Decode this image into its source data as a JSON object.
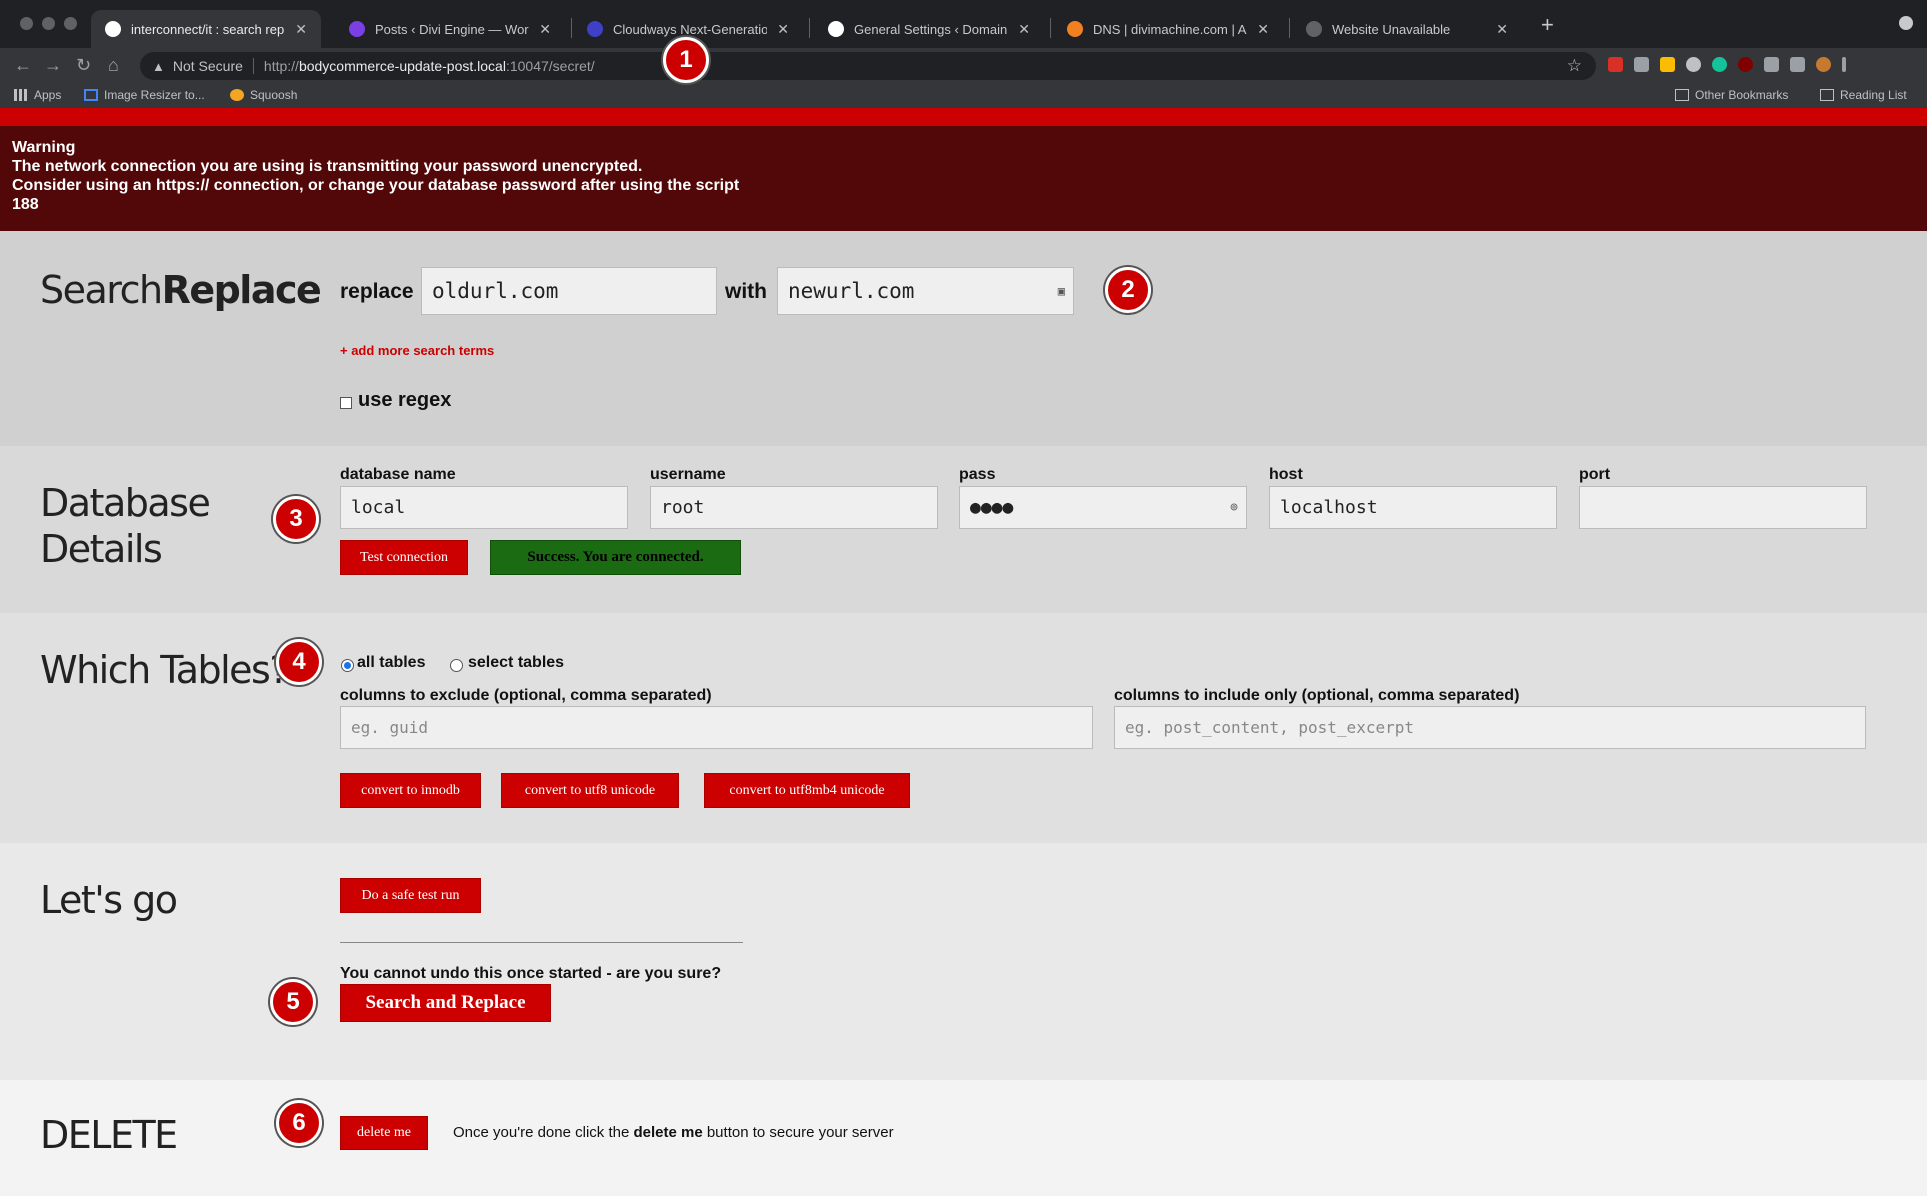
{
  "browser": {
    "tabs": [
      {
        "title": "interconnect/it : search replace",
        "active": true,
        "favicon_color": "#ffffff",
        "favicon": "wordpress-icon"
      },
      {
        "title": "Posts ‹ Divi Engine — WordPre",
        "active": false,
        "favicon_color": "#7b3fe4",
        "favicon": "divi-engine-icon"
      },
      {
        "title": "Cloudways Next-Generation Cl",
        "active": false,
        "favicon_color": "#3f3fc8",
        "favicon": "cloudways-icon"
      },
      {
        "title": "General Settings ‹ Domain Nar",
        "active": false,
        "favicon_color": "#ffffff",
        "favicon": "wordpress-icon"
      },
      {
        "title": "DNS | divimachine.com | Acco",
        "active": false,
        "favicon_color": "#f38020",
        "favicon": "cloudflare-icon"
      },
      {
        "title": "Website Unavailable",
        "active": false,
        "favicon_color": "#5f6368",
        "favicon": "globe-icon"
      }
    ],
    "address": {
      "security_label": "Not Secure",
      "url_prefix": "http://",
      "url_host": "bodycommerce-update-post.local",
      "url_rest": ":10047/secret/"
    },
    "bookmarks": {
      "apps": "Apps",
      "items": [
        "Image Resizer to...",
        "Squoosh"
      ],
      "other": "Other Bookmarks",
      "reading_list": "Reading List"
    },
    "colors": {
      "frame": "#202124",
      "toolbar": "#35363a"
    }
  },
  "warning": {
    "heading": "Warning",
    "line1": "The network connection you are using is transmitting your password unencrypted.",
    "line2": "Consider using an https:// connection, or change your database password after using the script",
    "line3": "188"
  },
  "search_replace": {
    "title_light": "Search",
    "title_bold": "Replace",
    "replace_label": "replace",
    "replace_value": "oldurl.com",
    "with_label": "with",
    "with_value": "newurl.com",
    "add_more": "+ add more search terms",
    "regex_label": "use regex",
    "regex_checked": false
  },
  "database": {
    "title_line1": "Database",
    "title_line2": "Details",
    "fields": [
      {
        "label": "database name",
        "value": "local"
      },
      {
        "label": "username",
        "value": "root"
      },
      {
        "label": "pass",
        "value": "●●●●"
      },
      {
        "label": "host",
        "value": "localhost"
      },
      {
        "label": "port",
        "value": ""
      }
    ],
    "test_button": "Test connection",
    "status": "Success. You are connected."
  },
  "tables": {
    "title": "Which Tables?",
    "all_tables": "all tables",
    "select_tables": "select tables",
    "selected": "all tables",
    "exclude_label": "columns to exclude (optional, comma separated)",
    "exclude_placeholder": "eg. guid",
    "include_label": "columns to include only (optional, comma separated)",
    "include_placeholder": "eg. post_content, post_excerpt",
    "buttons": [
      "convert to innodb",
      "convert to utf8 unicode",
      "convert to utf8mb4 unicode"
    ]
  },
  "go": {
    "title": "Let's go",
    "dry_run": "Do a safe test run",
    "confirm": "You cannot undo this once started - are you sure?",
    "run": "Search and Replace"
  },
  "delete": {
    "title": "DELETE",
    "button": "delete me",
    "text_before": "Once you're done click the ",
    "text_bold": "delete me",
    "text_after": " button to secure your server"
  },
  "annotations": [
    "1",
    "2",
    "3",
    "4",
    "5",
    "6"
  ],
  "accent": "#cc0000",
  "success_color": "#1a6b12"
}
